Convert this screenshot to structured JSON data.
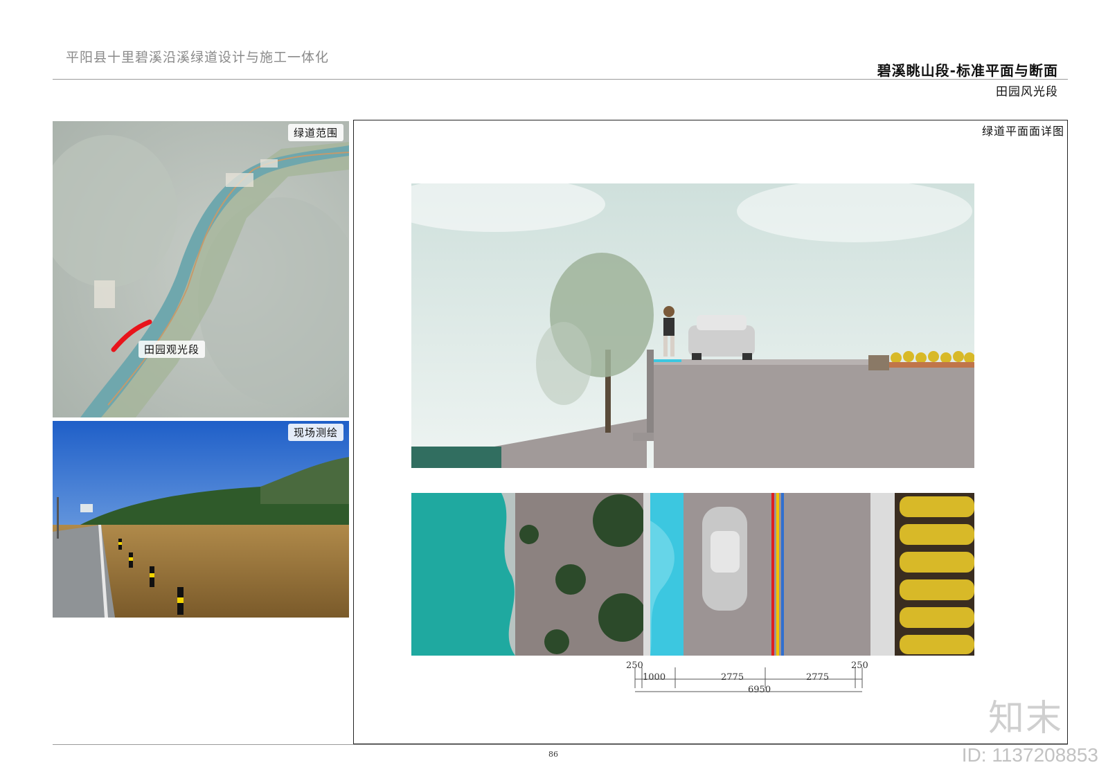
{
  "header": {
    "project_title": "平阳县十里碧溪沿溪绿道设计与施工一体化",
    "sheet_title": "碧溪眺山段-标准平面与断面",
    "sheet_subtitle": "田园风光段"
  },
  "left_panels": {
    "map_label": "绿道范围",
    "map_segment_label": "田园观光段",
    "photo_label": "现场测绘"
  },
  "main_panel": {
    "label": "绿道平面面详图"
  },
  "dimensions": {
    "left_curb": "250",
    "right_curb": "250",
    "bike_lane": "1000",
    "lane_left": "2775",
    "lane_right": "2775",
    "total": "6950"
  },
  "footer": {
    "page_number": "86"
  },
  "watermark": {
    "brand": "知末",
    "id": "ID: 1137208853"
  },
  "colors": {
    "river": "#1fa9a0",
    "bike_lane": "#3cc7e0",
    "road": "#9c9494",
    "highlight_segment": "#e8141b",
    "center_line_red": "#e02020",
    "center_line_yellow": "#f2c400",
    "center_line_blue": "#2f6fd0",
    "flower": "#d8b928"
  }
}
